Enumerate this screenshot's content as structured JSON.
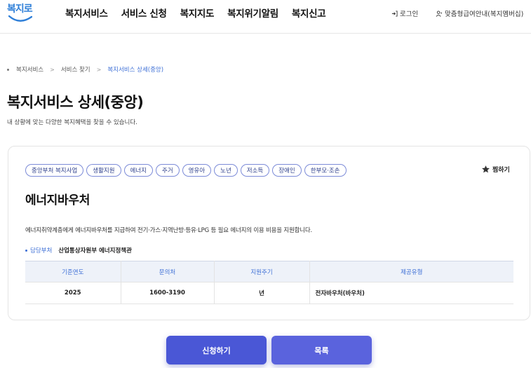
{
  "header": {
    "logo_text": "복지로",
    "nav": [
      "복지서비스",
      "서비스 신청",
      "복지지도",
      "복지위기알림",
      "복지신고"
    ],
    "login_label": "로그인",
    "guide_label": "맞춤형급여안내(복지멤버십)"
  },
  "breadcrumb": {
    "items": [
      "복지서비스",
      "서비스 찾기",
      "복지서비스 상세(중앙)"
    ]
  },
  "page": {
    "title": "복지서비스 상세(중앙)",
    "subtitle": "내 상황에 맞는 다양한 복지혜택을 찾을 수 있습니다."
  },
  "service": {
    "tags": [
      "중앙부처 복지사업",
      "생활지원",
      "에너지",
      "주거",
      "영유아",
      "노년",
      "저소득",
      "장애인",
      "한부모·조손"
    ],
    "bookmark_label": "찜하기",
    "title": "에너지바우처",
    "description": "에너지취약계층에게 에너지바우처를 지급하여 전기·가스·지역난방·등유·LPG 등 필요 에너지의 이용 비용을 지원합니다.",
    "dept_label": "담당부처",
    "dept_value": "산업통상자원부 에너지정책관",
    "table": {
      "headers": [
        "기준연도",
        "문의처",
        "지원주기",
        "제공유형"
      ],
      "row": [
        "2025",
        "1600-3190",
        "년",
        "전자바우처(바우처)"
      ]
    }
  },
  "buttons": {
    "apply": "신청하기",
    "list": "목록"
  },
  "colors": {
    "accent": "#3d6fd6",
    "button": "#4a57d6",
    "tag_border": "#7c8bd8"
  }
}
